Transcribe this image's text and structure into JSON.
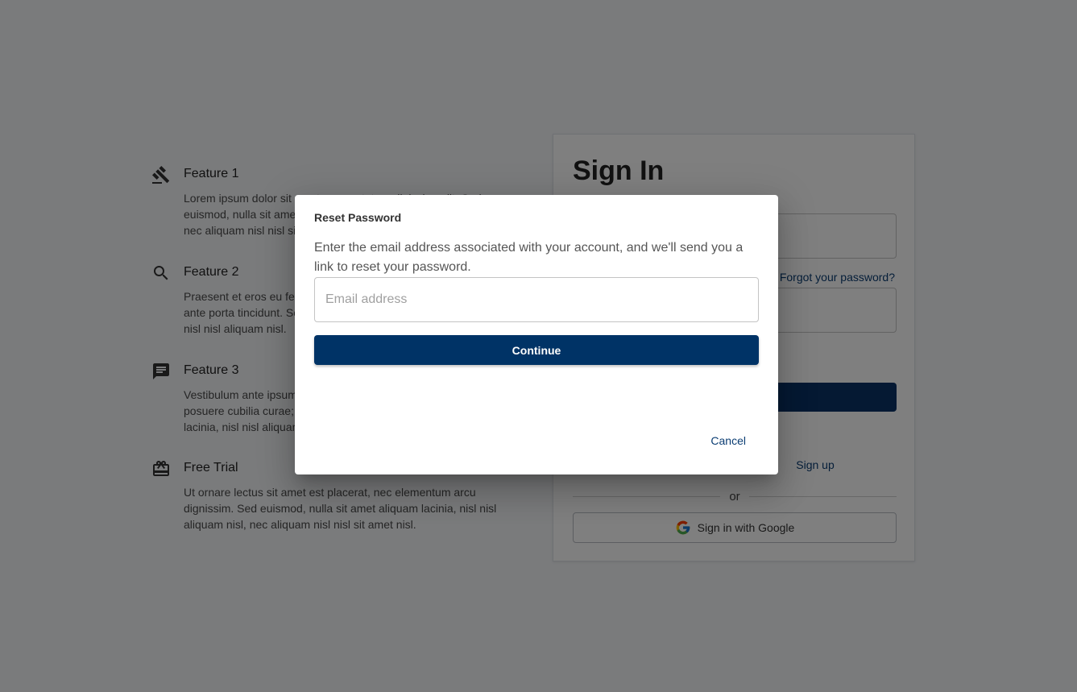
{
  "features": [
    {
      "icon": "gavel-icon",
      "title": "Feature 1",
      "text": "Lorem ipsum dolor sit amet, consectetur adipiscing elit. Sed euismod, nulla sit amet aliquam lacinia, nisl nisl aliquam nisl, nec aliquam nisl nisl sit amet nisl."
    },
    {
      "icon": "search-icon",
      "title": "Feature 2",
      "text": "Praesent et eros eu felis eleifend egestas. Nunc ultricies lacus ante porta tincidunt. Sed euismod, nulla sit amet aliquam lacinia, nisl nisl aliquam nisl."
    },
    {
      "icon": "message-icon",
      "title": "Feature 3",
      "text": "Vestibulum ante ipsum primis in faucibus orci luctus et ultrices posuere cubilia curae; Sed euismod, nulla sit amet aliquam lacinia, nisl nisl aliquam nisl."
    },
    {
      "icon": "gift-card-icon",
      "title": "Free Trial",
      "text": "Ut ornare lectus sit amet est placerat, nec elementum arcu dignissim. Sed euismod, nulla sit amet aliquam lacinia, nisl nisl aliquam nisl, nec aliquam nisl nisl sit amet nisl."
    }
  ],
  "signin": {
    "title": "Sign In",
    "forgot_password": "Forgot your password?",
    "signup_link": "Sign up",
    "or": "or",
    "google_button": "Sign in with Google"
  },
  "dialog": {
    "title": "Reset Password",
    "description": "Enter the email address associated with your account, and we'll send you a link to reset your password.",
    "email_placeholder": "Email address",
    "continue_label": "Continue",
    "cancel_label": "Cancel"
  },
  "colors": {
    "primary": "#003366",
    "link": "#0b3d73",
    "backdrop": "rgba(0,0,0,0.5)"
  }
}
